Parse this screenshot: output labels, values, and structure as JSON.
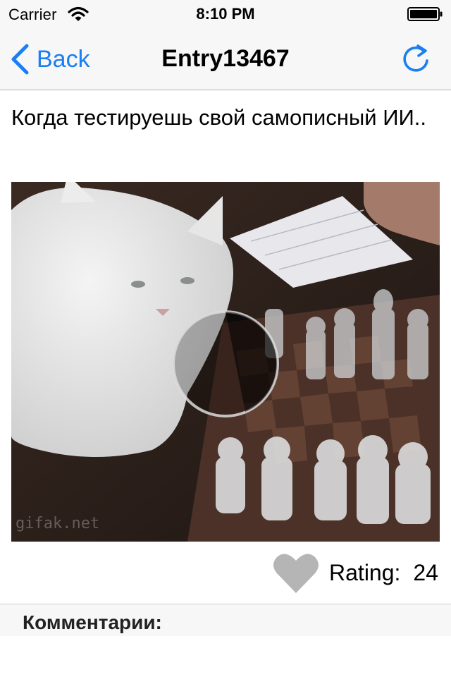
{
  "status_bar": {
    "carrier": "Carrier",
    "time": "8:10 PM"
  },
  "nav": {
    "back_label": "Back",
    "title": "Entry13467",
    "accent_color": "#1a7ff0"
  },
  "entry": {
    "text": "Когда тестируешь свой самописный ИИ..",
    "media_watermark": "gifak.net"
  },
  "rating": {
    "label": "Rating:",
    "value": "24",
    "heart_color": "#b5b5b5"
  },
  "comments": {
    "header": "Комментарии:"
  },
  "icons": {
    "back": "chevron-left-icon",
    "refresh": "refresh-icon",
    "heart": "heart-icon",
    "wifi": "wifi-icon",
    "battery": "battery-icon"
  }
}
